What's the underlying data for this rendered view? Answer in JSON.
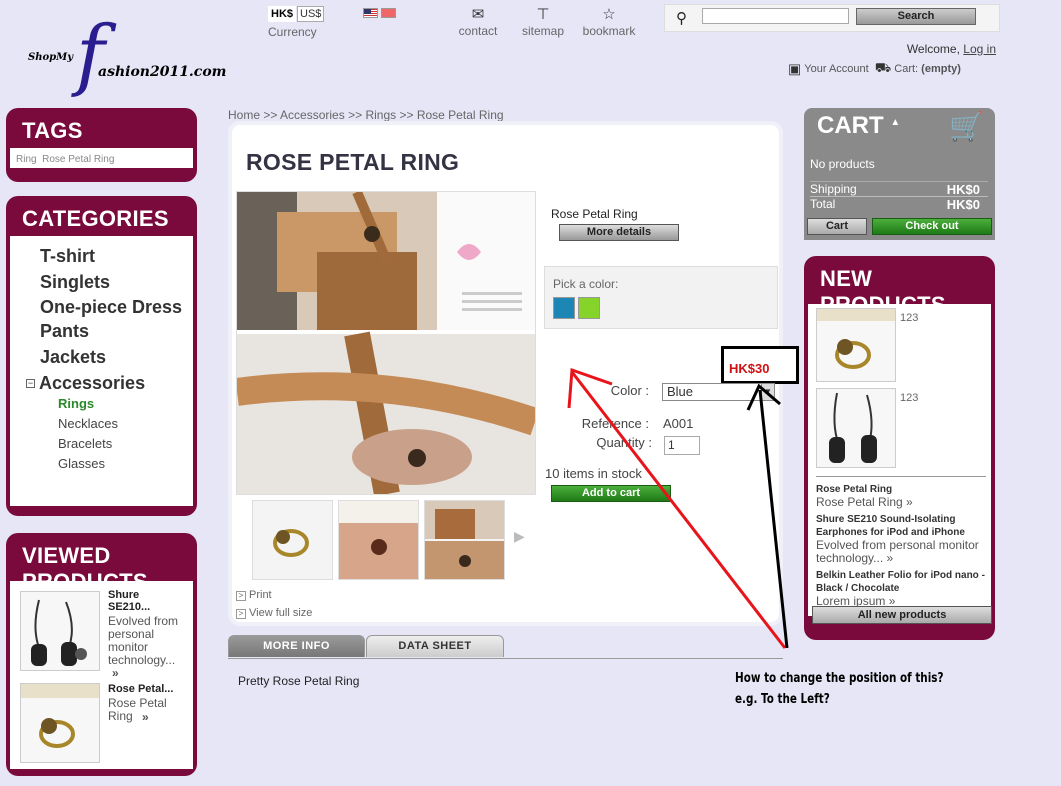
{
  "header": {
    "logo_small": "ShopMy",
    "logo_letter": "f",
    "logo_main": "ashion2011.com",
    "currencies": [
      "HK$",
      "US$"
    ],
    "currency_label": "Currency",
    "links": [
      {
        "label": "contact",
        "icon": "envelope-icon"
      },
      {
        "label": "sitemap",
        "icon": "sitemap-icon"
      },
      {
        "label": "bookmark",
        "icon": "star-icon"
      }
    ],
    "search": {
      "value": "",
      "button": "Search"
    },
    "welcome": "Welcome,",
    "login": "Log in",
    "account": "Your Account",
    "cart_label": "Cart:",
    "cart_value": "(empty)"
  },
  "tags": {
    "title": "TAGS",
    "items": [
      "Ring",
      "Rose Petal Ring"
    ]
  },
  "categories": {
    "title": "CATEGORIES",
    "items": [
      "T-shirt",
      "Singlets",
      "One-piece Dress",
      "Pants",
      "Jackets",
      "Accessories"
    ],
    "expander": "−",
    "subitems": [
      "Rings",
      "Necklaces",
      "Bracelets",
      "Glasses"
    ]
  },
  "viewed": {
    "title": "VIEWED PRODUCTS",
    "items": [
      {
        "name": "Shure SE210...",
        "desc": "Evolved from personal monitor technology...",
        "more": "»"
      },
      {
        "name": "Rose Petal...",
        "desc": "Rose Petal Ring",
        "more": "»"
      }
    ]
  },
  "breadcrumb": [
    "Home",
    ">>",
    "Accessories",
    ">>",
    "Rings",
    ">>",
    "Rose Petal Ring"
  ],
  "product": {
    "title": "ROSE PETAL RING",
    "short_name": "Rose Petal Ring",
    "more_details": "More details",
    "pick_color": "Pick a color:",
    "swatches": [
      "#1c86b4",
      "#86d32a"
    ],
    "price": "HK$30",
    "color_label": "Color :",
    "color_value": "Blue",
    "reference_label": "Reference :",
    "reference_value": "A001",
    "quantity_label": "Quantity :",
    "quantity_value": "1",
    "stock": "10 items in stock",
    "add_to_cart": "Add to cart",
    "print": "Print",
    "view_full_size": "View full size"
  },
  "tabs": [
    "MORE INFO",
    "DATA SHEET"
  ],
  "tab_content": "Pretty Rose Petal Ring",
  "cart_block": {
    "title": "CART",
    "arrow": "▲",
    "no_products": "No products",
    "shipping_label": "Shipping",
    "shipping_value": "HK$0",
    "total_label": "Total",
    "total_value": "HK$0",
    "cart_button": "Cart",
    "checkout_button": "Check out"
  },
  "new_products": {
    "title": "NEW PRODUCTS",
    "thumb_labels": [
      "123",
      "123"
    ],
    "items": [
      {
        "name": "Rose Petal Ring",
        "desc": "Rose Petal Ring »"
      },
      {
        "name": "Shure SE210 Sound-Isolating Earphones for iPod and iPhone",
        "desc": "Evolved from personal monitor technology... »"
      },
      {
        "name": "Belkin Leather Folio for iPod nano - Black / Chocolate",
        "desc": "Lorem ipsum »"
      }
    ],
    "all_button": "All new products"
  },
  "annotation": {
    "line1": "How to change the position of this?",
    "line2": "e.g. To the Left?"
  },
  "colors": {
    "accent": "#7a0a3b",
    "price_red": "#d01010",
    "green_button": "#2a8a22",
    "page_bg": "#e6e6f7"
  }
}
